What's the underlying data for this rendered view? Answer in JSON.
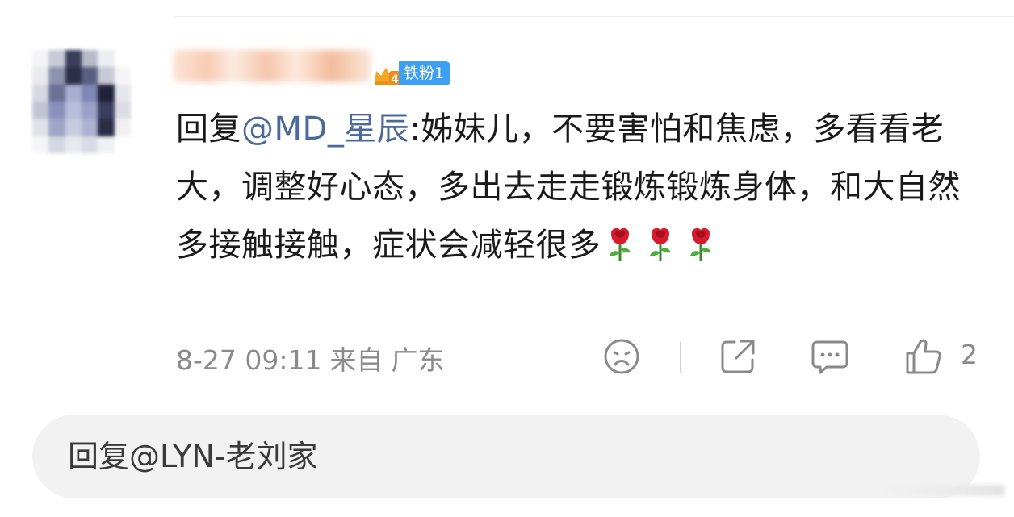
{
  "author": {
    "fan_badge": "铁粉1",
    "vip_level": "4"
  },
  "comment": {
    "reply_prefix": "回复",
    "mention": "@MD_星辰",
    "text": ":姊妹儿，不要害怕和焦虑，多看看老大，调整好心态，多出去走走锻炼锻炼身体，和大自然多接触接触，症状会减轻很多",
    "emoji": [
      "rose-emoji",
      "rose-emoji",
      "rose-emoji"
    ]
  },
  "meta": {
    "time": "8-27 09:11",
    "source_label": "来自",
    "location": "广东"
  },
  "actions": {
    "dislike_icon": "sad-face-icon",
    "share_icon": "share-icon",
    "comment_icon": "comment-bubble-icon",
    "like_icon": "thumbs-up-icon",
    "like_count": "2"
  },
  "reply_input": {
    "placeholder": "回复@LYN-老刘家"
  },
  "colors": {
    "mention": "#4b6a9b",
    "fan_badge": "#3ea0f0",
    "meta_text": "#8a8a8a",
    "input_bg": "#f2f2f2"
  }
}
